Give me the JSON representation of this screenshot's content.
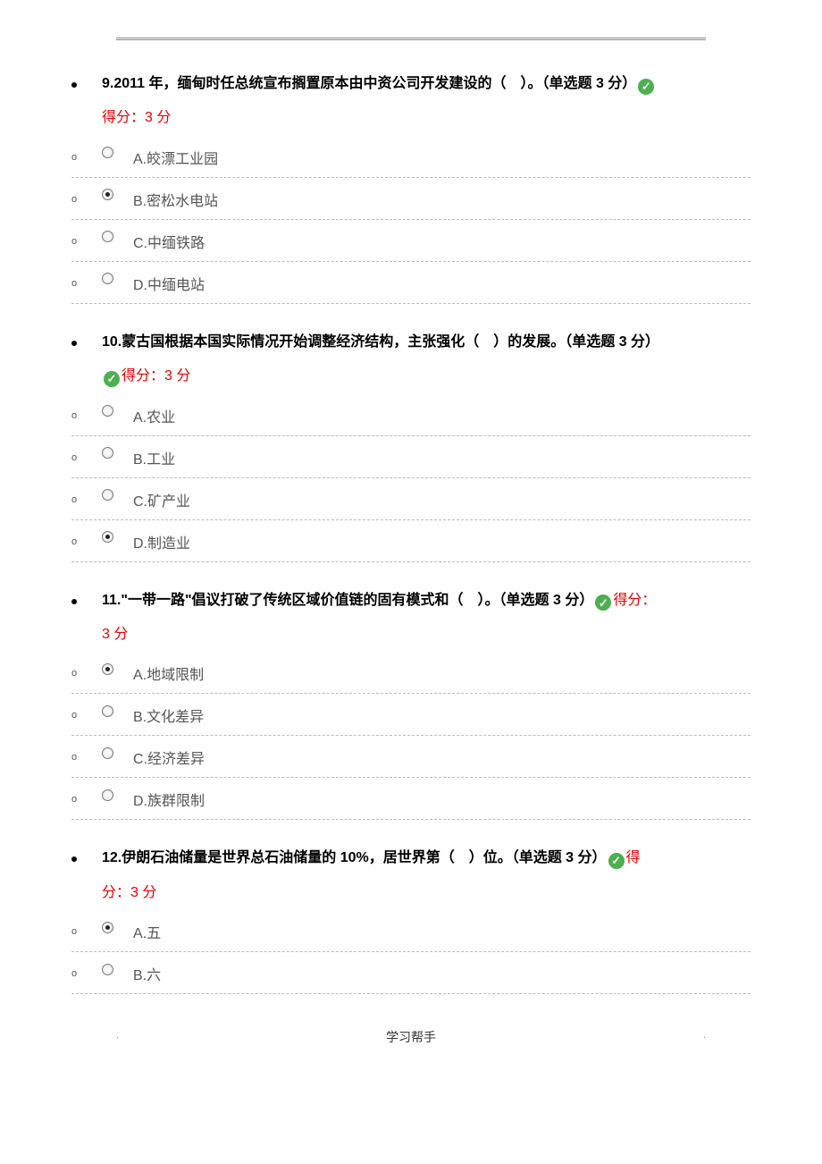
{
  "header": {
    "dots": [
      "..",
      ".",
      ".",
      ".."
    ]
  },
  "questions": [
    {
      "number": "9.",
      "stem": "2011 年，缅甸时任总统宣布搁置原本由中资公司开发建设的（　）。",
      "type_label": "（单选题 3 分）",
      "score_prefix": "",
      "score": "得分：3 分",
      "check_before_score": false,
      "check_after_type": true,
      "options": [
        {
          "letter": "A.",
          "text": "皎漂工业园",
          "selected": false
        },
        {
          "letter": "B.",
          "text": "密松水电站",
          "selected": true
        },
        {
          "letter": "C.",
          "text": "中缅铁路",
          "selected": false
        },
        {
          "letter": "D.",
          "text": "中缅电站",
          "selected": false
        }
      ]
    },
    {
      "number": "10.",
      "stem": "蒙古国根据本国实际情况开始调整经济结构，主张强化（　）的发展。",
      "type_label": "（单选题 3 分）",
      "score_prefix": "",
      "score": "得分：3 分",
      "check_before_score": true,
      "check_after_type": false,
      "options": [
        {
          "letter": "A.",
          "text": "农业",
          "selected": false
        },
        {
          "letter": "B.",
          "text": "工业",
          "selected": false
        },
        {
          "letter": "C.",
          "text": "矿产业",
          "selected": false
        },
        {
          "letter": "D.",
          "text": "制造业",
          "selected": true
        }
      ]
    },
    {
      "number": "11.",
      "stem": "\"一带一路\"倡议打破了传统区域价值链的固有模式和（　）。",
      "type_label": "（单选题 3 分）",
      "score_prefix": "得分：",
      "score": "3 分",
      "check_before_score": false,
      "check_after_type": true,
      "inline_score": true,
      "options": [
        {
          "letter": "A.",
          "text": "地域限制",
          "selected": true
        },
        {
          "letter": "B.",
          "text": "文化差异",
          "selected": false
        },
        {
          "letter": "C.",
          "text": "经济差异",
          "selected": false
        },
        {
          "letter": "D.",
          "text": "族群限制",
          "selected": false
        }
      ]
    },
    {
      "number": "12.",
      "stem": "伊朗石油储量是世界总石油储量的 10%，居世界第（　）位。",
      "type_label": "（单选题 3 分）",
      "score_prefix": "得",
      "score": "分：3 分",
      "check_before_score": false,
      "check_after_type": true,
      "inline_score": true,
      "inline_split": true,
      "options": [
        {
          "letter": "A.",
          "text": "五",
          "selected": true
        },
        {
          "letter": "B.",
          "text": "六",
          "selected": false
        }
      ]
    }
  ],
  "footer": {
    "left": ".",
    "right": ".",
    "center": "学习帮手"
  }
}
